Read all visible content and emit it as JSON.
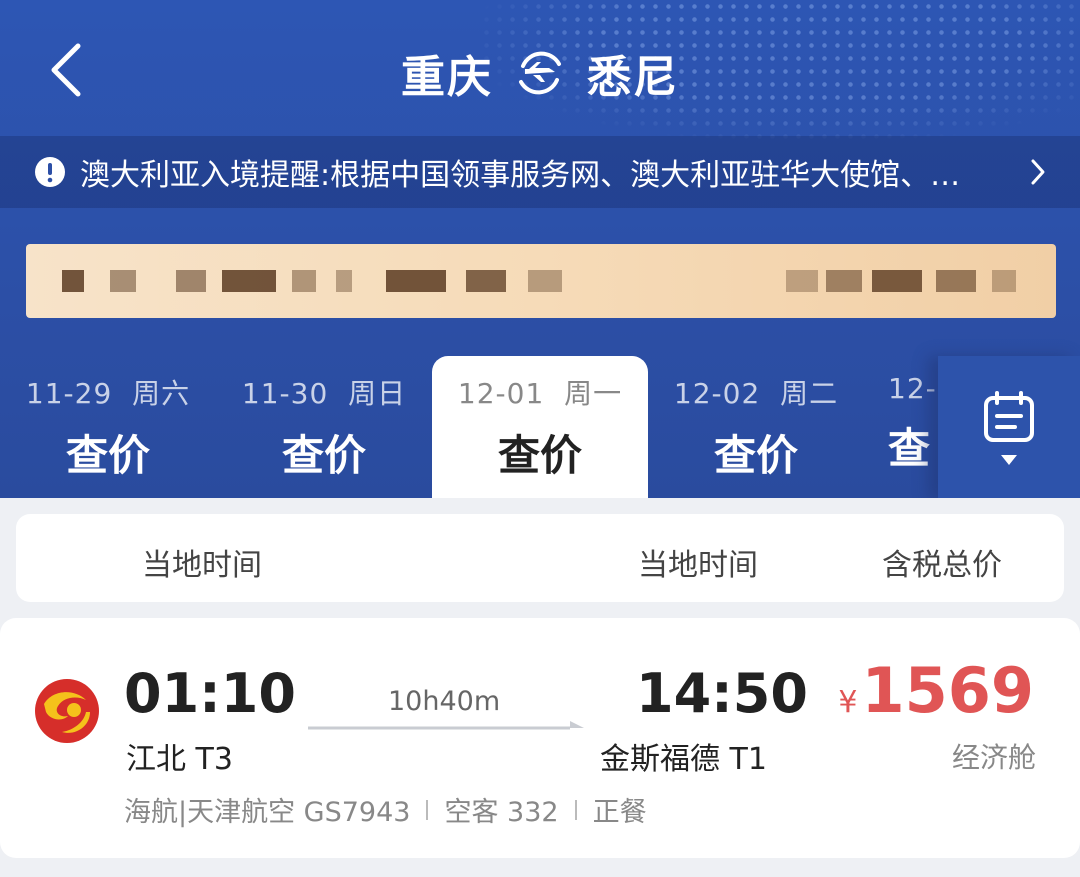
{
  "header": {
    "origin": "重庆",
    "destination": "悉尼",
    "icons": {
      "back": "back-chevron-icon",
      "route": "plane-circle-icon"
    }
  },
  "notice": {
    "text": "澳大利亚入境提醒:根据中国领事服务网、澳大利亚驻华大使馆、…",
    "icon": "exclamation-circle-icon"
  },
  "date_tabs": [
    {
      "date": "11-29",
      "weekday": "周六",
      "price": "查价"
    },
    {
      "date": "11-30",
      "weekday": "周日",
      "price": "查价"
    },
    {
      "date": "12-01",
      "weekday": "周一",
      "price": "查价",
      "selected": true
    },
    {
      "date": "12-02",
      "weekday": "周二",
      "price": "查价"
    },
    {
      "date": "12-",
      "weekday": "",
      "price": "查"
    }
  ],
  "calendar_icon": "calendar-icon",
  "columns": {
    "departure": "当地时间",
    "arrival": "当地时间",
    "price": "含税总价"
  },
  "flight": {
    "dep_time": "01:10",
    "dep_airport": "江北 T3",
    "duration": "10h40m",
    "arr_time": "14:50",
    "arr_airport": "金斯福德 T1",
    "currency": "¥",
    "price": "1569",
    "cabin": "经济舱",
    "airline": "海航|天津航空 GS7943",
    "aircraft": "空客 332",
    "meal": "正餐"
  },
  "colors": {
    "header_blue": "#2d56b4",
    "price_red": "#e05555",
    "banner_gold": "#f6dbb8"
  }
}
